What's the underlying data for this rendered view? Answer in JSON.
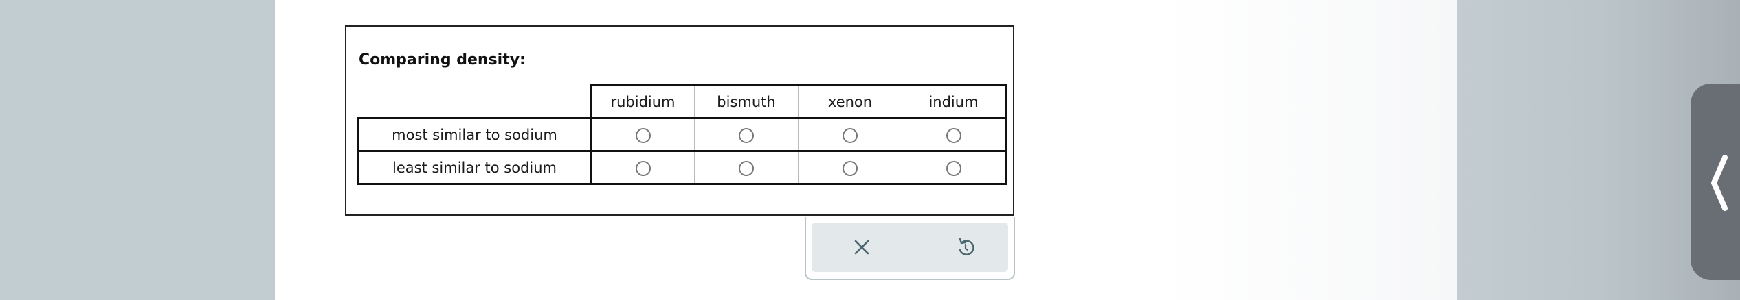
{
  "question": {
    "title": "Comparing density:",
    "columns": [
      "rubidium",
      "bismuth",
      "xenon",
      "indium"
    ],
    "rows": [
      {
        "label": "most similar to sodium"
      },
      {
        "label": "least similar to sodium"
      }
    ]
  },
  "toolbar": {
    "clear_icon": "close-icon",
    "undo_icon": "undo-icon"
  },
  "side_panel": {
    "toggle_icon": "chevron-left-icon",
    "tab_color": "#686e73"
  },
  "colors": {
    "background": "#c2cdd1",
    "page": "#ffffff",
    "toolbar_bg": "#e3e8ea",
    "icon": "#4a6470"
  }
}
